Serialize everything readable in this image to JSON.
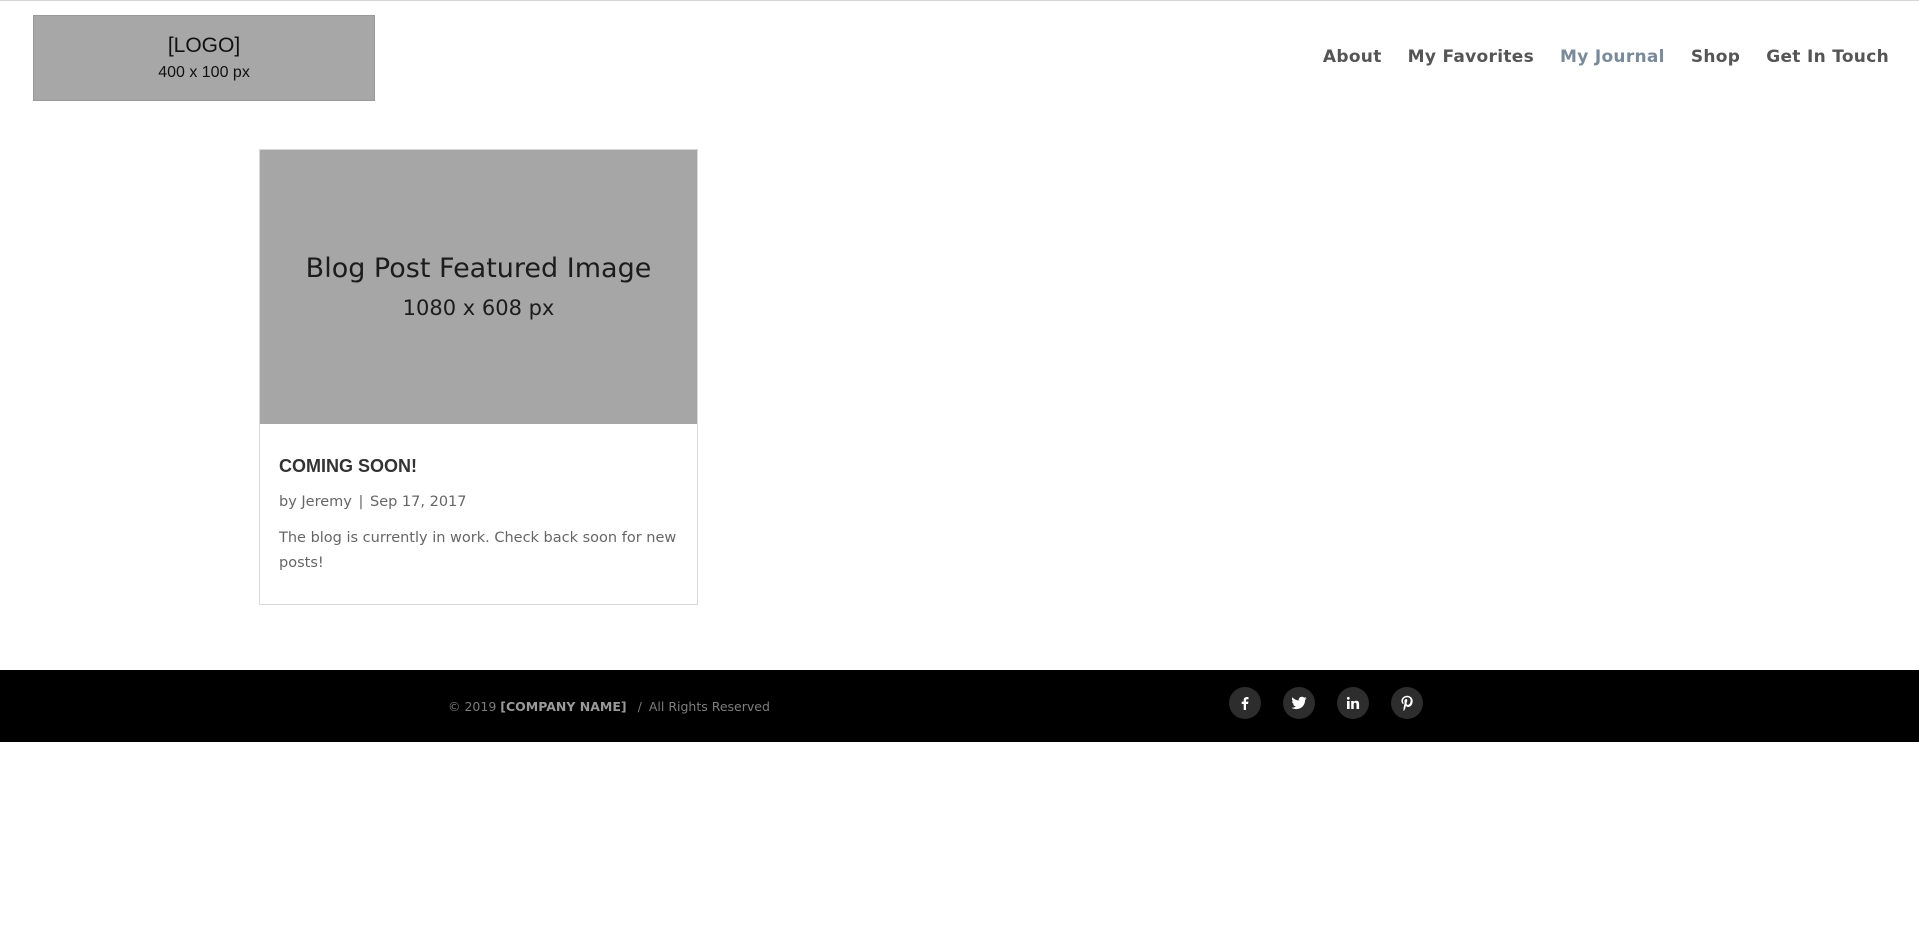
{
  "header": {
    "logo": {
      "line1": "[LOGO]",
      "line2": "400 x 100 px"
    },
    "nav": [
      {
        "label": "About"
      },
      {
        "label": "My Favorites"
      },
      {
        "label": "My Journal"
      },
      {
        "label": "Shop"
      },
      {
        "label": "Get In Touch"
      }
    ],
    "active_nav": "My Journal"
  },
  "post": {
    "featured_image": {
      "line1": "Blog Post Featured Image",
      "line2": "1080 x 608 px"
    },
    "title": "COMING SOON!",
    "meta": {
      "by": "by",
      "author": "Jeremy",
      "separator": "|",
      "date": "Sep 17, 2017"
    },
    "excerpt": "The blog is currently in work.  Check back soon for new posts!"
  },
  "footer": {
    "copyright_prefix": "© 2019",
    "company": "[COMPANY NAME]",
    "slash": "/",
    "rights": "All Rights Reserved",
    "socials": [
      {
        "icon": "facebook-icon"
      },
      {
        "icon": "twitter-icon"
      },
      {
        "icon": "linkedin-icon"
      },
      {
        "icon": "pinterest-icon"
      }
    ]
  },
  "colors": {
    "nav_text": "#555555",
    "nav_active": "#7a8a9a",
    "placeholder_gray": "#a6a6a6",
    "footer_bg": "#000000"
  }
}
